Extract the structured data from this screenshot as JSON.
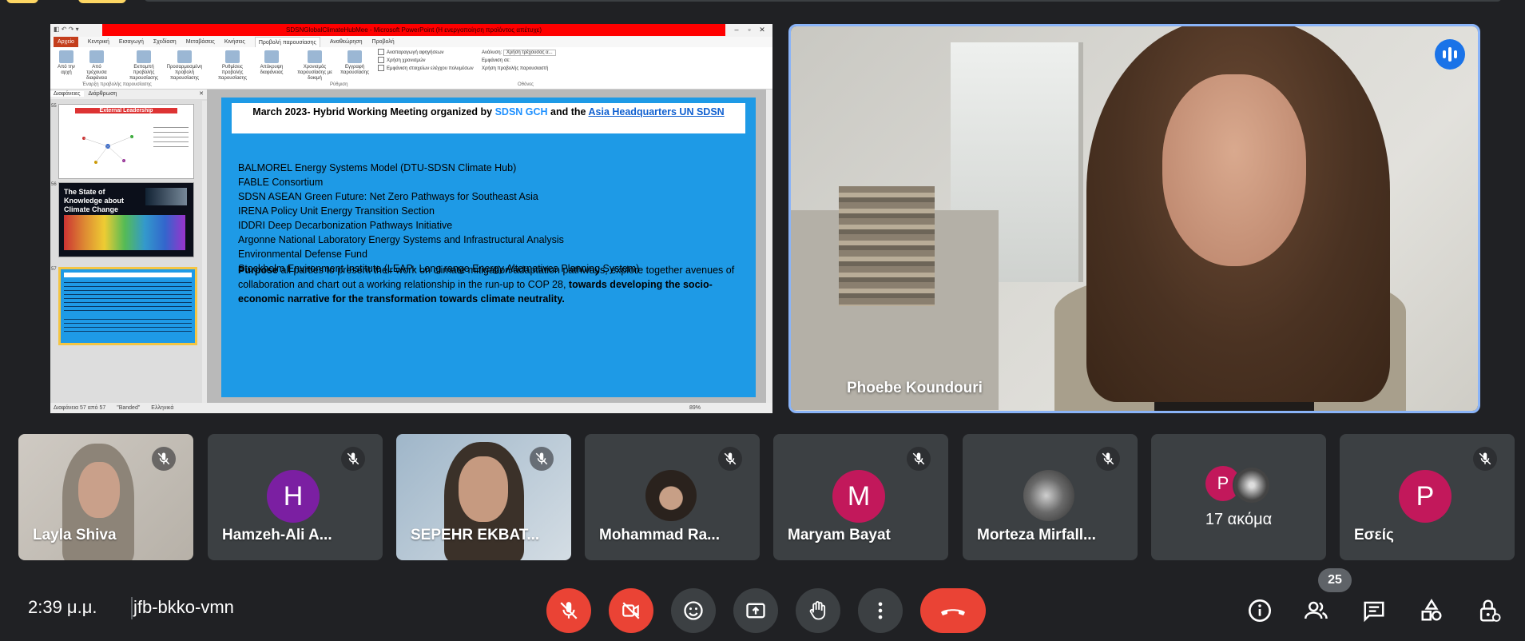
{
  "shared_screen": {
    "window_title": "SDSNGlobalClimateHubMee - Microsoft PowerPoint (Η ενεργοποίηση προϊόντος απέτυχε)",
    "ribbon_tabs": [
      "Αρχείο",
      "Κεντρική",
      "Εισαγωγή",
      "Σχεδίαση",
      "Μεταβάσεις",
      "Κινήσεις",
      "Προβολή παρουσίασης",
      "Αναθεώρηση",
      "Προβολή"
    ],
    "ribbon_buttons": [
      "Από την αρχή",
      "Από τρέχουσα διαφάνεια",
      "Εκπομπή προβολής παρουσίασης",
      "Προσαρμοσμένη προβολή παρουσίασης",
      "Ρυθμίσεις προβολής παρουσίασης",
      "Απόκρυψη διαφάνειας",
      "Χρονισμός παρουσίασης με δοκιμή",
      "Εγγραφή παρουσίασης"
    ],
    "ribbon_checks": [
      "Αναπαραγωγή αφηγήσεων",
      "Χρήση χρονισμών",
      "Εμφάνιση στοιχείων ελέγχου πολυμέσων"
    ],
    "ribbon_monitor": {
      "label": "Ανάλυση:",
      "value": "Χρήση τρέχουσας α...",
      "show_on": "Εμφάνιση σε:",
      "presenter": "Χρήση προβολής παρουσιαστή"
    },
    "ribbon_groups": [
      "Έναρξη προβολής παρουσίασης",
      "Ρύθμιση",
      "Οθόνες"
    ],
    "left_tabs": [
      "Διαφάνειες",
      "Διάρθρωση"
    ],
    "thumbnails": [
      {
        "num": "55",
        "title": "External Leadership"
      },
      {
        "num": "56",
        "title": "The State of Knowledge about Climate Change"
      },
      {
        "num": "57",
        "title": ""
      }
    ],
    "slide": {
      "head_prefix": "March 2023- Hybrid Working Meeting organized by ",
      "head_org1": "SDSN GCH",
      "head_mid": " and the ",
      "head_org2": "Asia Headquarters UN SDSN",
      "items": [
        "BALMOREL Energy Systems Model (DTU-SDSN Climate Hub)",
        "FABLE Consortium",
        "SDSN ASEAN Green Future: Net Zero Pathways for Southeast Asia",
        "IRENA Policy Unit Energy Transition Section",
        "IDDRI Deep Decarbonization Pathways Initiative",
        "Argonne National Laboratory Energy Systems and Infrastructural Analysis",
        "Environmental Defense Fund",
        "Stockholm Environment Institute (LEAP- Long range Energy Alternatives Planning System)"
      ],
      "purpose_label": "Purpose",
      "purpose_text": " all parties to present their work on climate mitigation/adaptation pathways, explore together avenues of collaboration and chart out a working relationship in the run-up to COP 28, ",
      "purpose_bold": "towards developing the socio-economic narrative for the transformation towards climate neutrality."
    },
    "status_left": "Διαφάνεια 57 από 57",
    "status_theme": "\"Banded\"",
    "status_lang": "Ελληνικά",
    "status_zoom": "89%"
  },
  "speaker": {
    "name": "Phoebe Koundouri"
  },
  "participants": [
    {
      "name": "Layla Shiva",
      "type": "photo"
    },
    {
      "name": "Hamzeh-Ali A...",
      "type": "avatar",
      "initial": "H",
      "color": "#7b1fa2"
    },
    {
      "name": "SEPEHR EKBAT...",
      "type": "photo"
    },
    {
      "name": "Mohammad Ra...",
      "type": "photo-avatar"
    },
    {
      "name": "Maryam Bayat",
      "type": "avatar",
      "initial": "M",
      "color": "#c2185b"
    },
    {
      "name": "Morteza Mirfall...",
      "type": "photo-avatar"
    },
    {
      "name": "17 ακόμα",
      "type": "more",
      "initial": "P",
      "color": "#c2185b"
    },
    {
      "name": "Εσείς",
      "type": "avatar",
      "initial": "P",
      "color": "#c2185b"
    }
  ],
  "bottom_bar": {
    "time": "2:39 μ.μ.",
    "meeting_code": "jfb-bkko-vmn",
    "people_count": "25"
  },
  "icons": {
    "mic": "mic-off-icon",
    "camera": "camera-off-icon",
    "emoji": "emoji-icon",
    "present": "present-icon",
    "hand": "raise-hand-icon",
    "more": "more-vert-icon",
    "leave": "end-call-icon",
    "info": "info-icon",
    "people": "people-icon",
    "chat": "chat-icon",
    "activities": "activities-icon",
    "host": "host-controls-icon"
  },
  "colors": {
    "accent_blue": "#8ab4f8",
    "danger_red": "#ea4335",
    "bg": "#202124",
    "tile": "#3c4043"
  }
}
